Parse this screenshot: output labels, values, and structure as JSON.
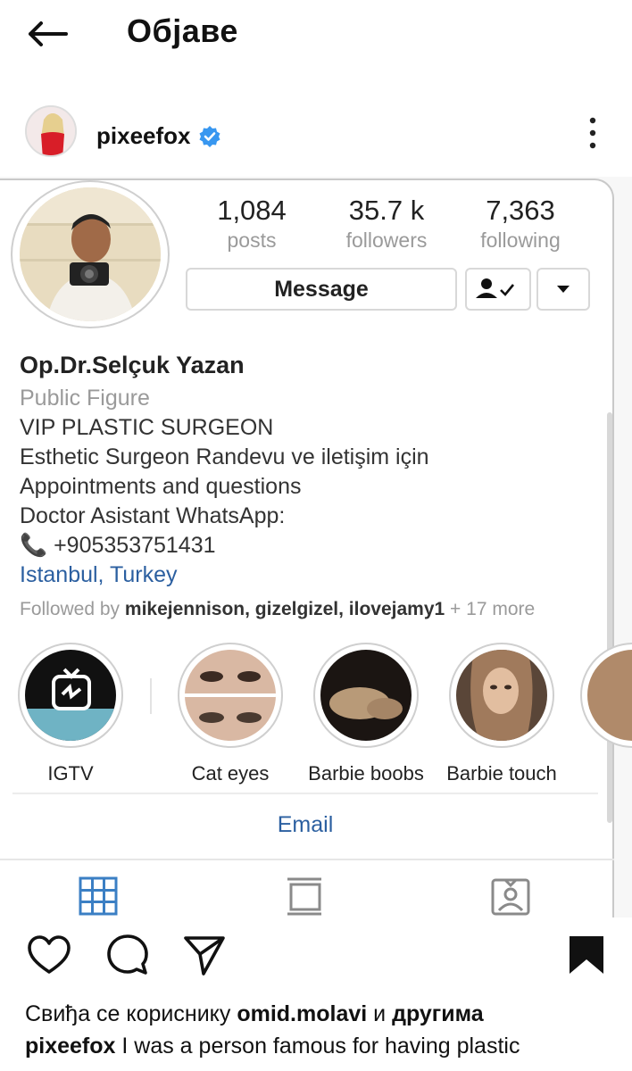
{
  "topbar": {
    "title": "Објаве"
  },
  "post": {
    "username": "pixeefox",
    "verified": true,
    "likes_prefix": "Свиђа се кориснику",
    "likes_user": "omid.molavi",
    "likes_conj": "и",
    "likes_others": "другима",
    "caption_user": "pixeefox",
    "caption_text": "I was a person famous for having plastic"
  },
  "profile": {
    "stats": [
      {
        "value": "1,084",
        "label": "posts"
      },
      {
        "value": "35.7 k",
        "label": "followers"
      },
      {
        "value": "7,363",
        "label": "following"
      }
    ],
    "message_label": "Message",
    "name": "Op.Dr.Selçuk Yazan",
    "category": "Public Figure",
    "bio_lines": [
      "VIP PLASTIC SURGEON",
      "Esthetic Surgeon Randevu ve iletişim için",
      "Appointments and questions",
      "Doctor Asistant WhatsApp:",
      "📞 +905353751431"
    ],
    "location": "Istanbul, Turkey",
    "followed_prefix": "Followed by",
    "followed_users": "mikejennison, gizelgizel, ilovejamy1",
    "followed_more": "+ 17 more",
    "highlights": [
      "IGTV",
      "Cat eyes",
      "Barbie boobs",
      "Barbie touch"
    ],
    "email_label": "Email"
  },
  "colors": {
    "link": "#2b5fa0",
    "verified": "#3897f0",
    "muted": "#9a9a9a"
  },
  "icons": [
    "back-arrow-icon",
    "verified-badge-icon",
    "more-vertical-icon",
    "follow-check-icon",
    "caret-down-icon",
    "grid-icon",
    "feed-icon",
    "tagged-icon",
    "heart-icon",
    "comment-icon",
    "share-icon",
    "bookmark-icon"
  ]
}
